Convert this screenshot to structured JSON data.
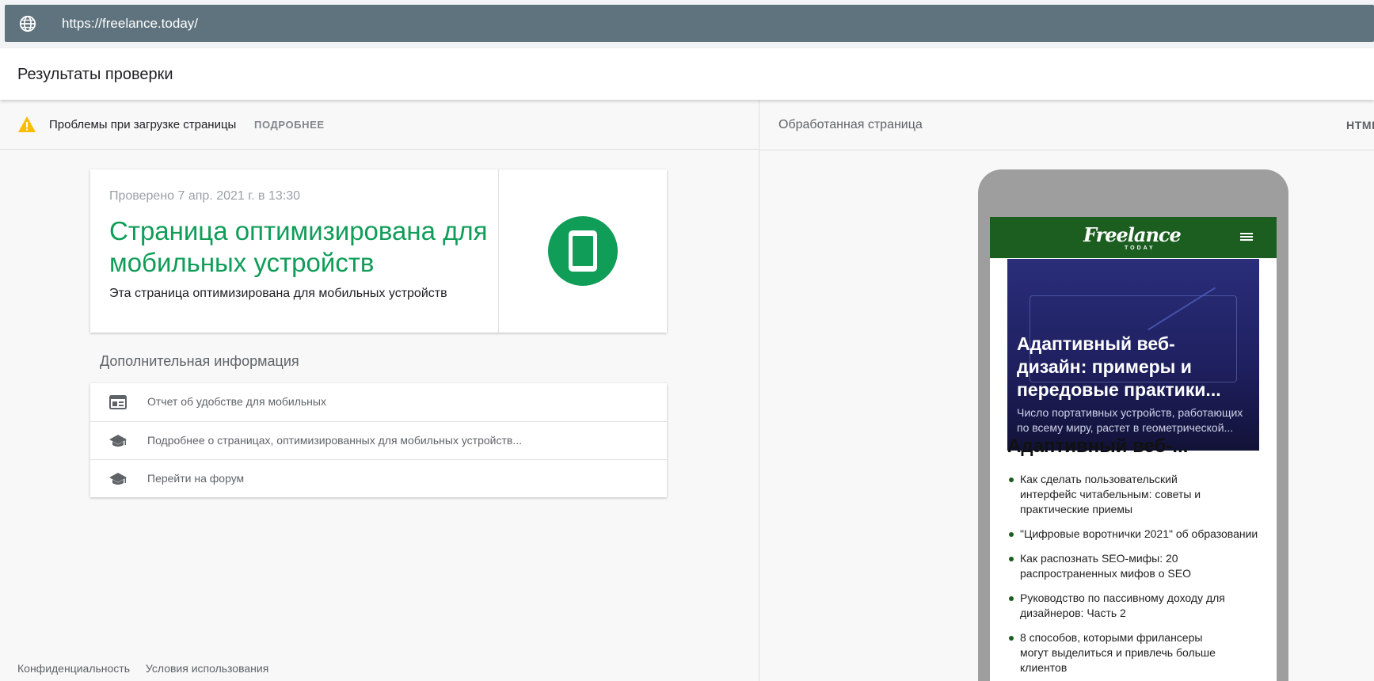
{
  "address_bar": {
    "url": "https://freelance.today/"
  },
  "header": {
    "title": "Результаты проверки"
  },
  "status": {
    "message": "Проблемы при загрузке страницы",
    "details_label": "ПОДРОБНЕЕ"
  },
  "result": {
    "checked_at": "Проверено 7 апр. 2021 г. в 13:30",
    "heading": "Страница оптимизирована для мобильных устройств",
    "description": "Эта страница оптимизирована для мобильных устройств"
  },
  "additional_info": {
    "title": "Дополнительная информация",
    "items": [
      {
        "label": "Отчет об удобстве для мобильных",
        "icon": "report-icon"
      },
      {
        "label": "Подробнее о страницах, оптимизированных для мобильных устройств...",
        "icon": "graduation-cap-icon"
      },
      {
        "label": "Перейти на форум",
        "icon": "graduation-cap-icon"
      }
    ]
  },
  "footer": {
    "privacy": "Конфиденциальность",
    "terms": "Условия использования"
  },
  "right_panel": {
    "label": "Обработанная страница",
    "html_tab": "HTML"
  },
  "preview": {
    "logo_main": "Freelance",
    "logo_sub": "TODAY",
    "hero_title": "Адаптивный веб-\nдизайн: примеры и\nпередовые практики...",
    "hero_subtitle": "Число портативных устройств, работающих по всему миру, растет в геометрической...",
    "article_title": "Адаптивный веб-...",
    "links": [
      "Как сделать пользовательский интерфейс читабельным: советы и практические приемы",
      "\"Цифровые воротнички 2021\" об образовании",
      "Как распознать SEO-мифы: 20 распространенных мифов о SEO",
      "Руководство по пассивному доходу для дизайнеров: Часть 2",
      "8 способов, которыми фрилансеры могут выделиться и привлечь больше клиентов"
    ]
  },
  "colors": {
    "success": "#0f9d58",
    "warning": "#fbbc04",
    "url_bar": "#5f737e",
    "site_header": "#1b5e20"
  }
}
